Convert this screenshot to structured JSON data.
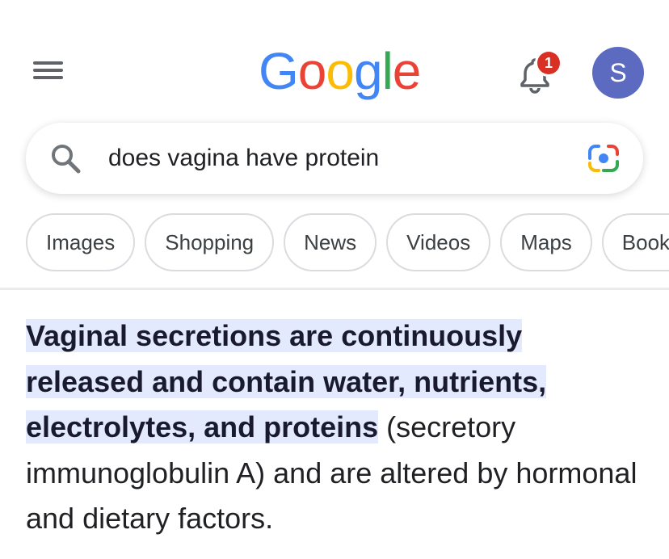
{
  "header": {
    "menu_icon": "hamburger-menu-icon",
    "logo": {
      "letters": [
        {
          "char": "G",
          "color": "#4285F4"
        },
        {
          "char": "o",
          "color": "#EA4335"
        },
        {
          "char": "o",
          "color": "#FBBC05"
        },
        {
          "char": "g",
          "color": "#4285F4"
        },
        {
          "char": "l",
          "color": "#34A853"
        },
        {
          "char": "e",
          "color": "#EA4335"
        }
      ]
    },
    "notifications": {
      "icon": "bell-icon",
      "count": "1"
    },
    "avatar_initial": "S"
  },
  "search": {
    "query": "does vagina have protein",
    "search_icon": "search-icon",
    "lens_icon": "google-lens-icon"
  },
  "chips": [
    {
      "label": "Images"
    },
    {
      "label": "Shopping"
    },
    {
      "label": "News"
    },
    {
      "label": "Videos"
    },
    {
      "label": "Maps"
    },
    {
      "label": "Books"
    }
  ],
  "answer": {
    "highlighted": "Vaginal secretions are continuously released and contain water, nutrients, electrolytes, and proteins",
    "rest": " (secretory immunoglobulin A) and are altered by hormonal and dietary factors."
  },
  "colors": {
    "highlight": "#e3eafd",
    "avatar": "#5c6bc0",
    "badge": "#d93025"
  }
}
